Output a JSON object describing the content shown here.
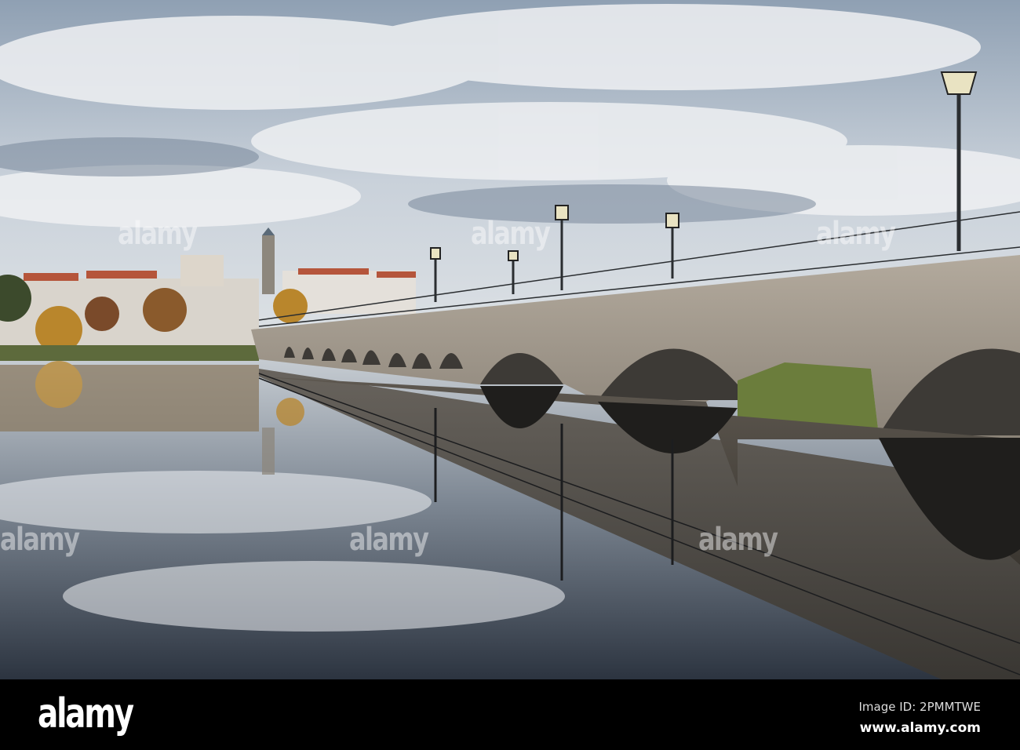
{
  "photo": {
    "subject": "stone-bridge-over-river",
    "colors": {
      "sky": "#b9c3cf",
      "cloud": "#e8ecf0",
      "stone": "#9a9186",
      "water_dark": "#3e4146",
      "moss": "#5f7a3a"
    }
  },
  "watermark": {
    "text": "alamy"
  },
  "footer": {
    "logo": "alamy",
    "image_id": "Image ID: 2PMMTWE",
    "url": "www.alamy.com"
  }
}
